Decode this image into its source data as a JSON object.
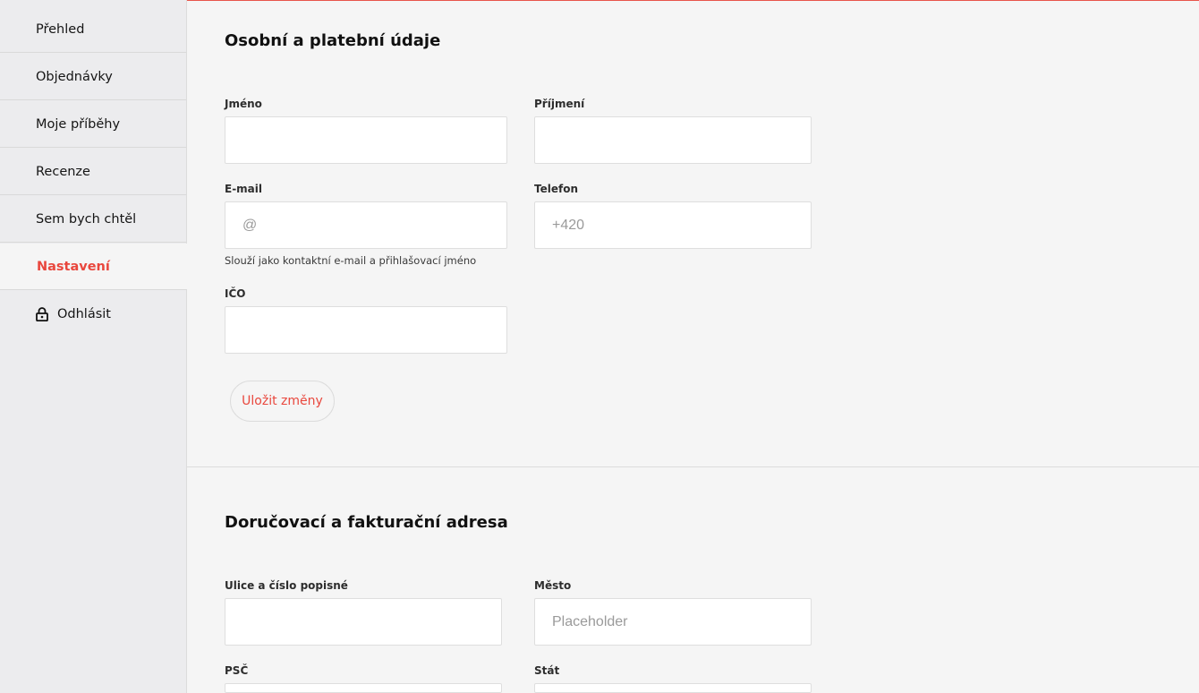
{
  "sidebar": {
    "items": [
      {
        "label": "Přehled"
      },
      {
        "label": "Objednávky"
      },
      {
        "label": "Moje příběhy"
      },
      {
        "label": "Recenze"
      },
      {
        "label": "Sem bych chtěl"
      },
      {
        "label": "Nastavení",
        "active": true
      },
      {
        "label": "Odhlásit",
        "icon": "lock-icon"
      }
    ]
  },
  "personal": {
    "title": "Osobní a platební údaje",
    "first_name": {
      "label": "Jméno",
      "value": "",
      "placeholder": ""
    },
    "last_name": {
      "label": "Příjmení",
      "value": "",
      "placeholder": ""
    },
    "email": {
      "label": "E-mail",
      "value": "",
      "placeholder": "@",
      "help": "Slouží jako kontaktní e-mail a přihlašovací jméno"
    },
    "phone": {
      "label": "Telefon",
      "value": "",
      "placeholder": "+420"
    },
    "ico": {
      "label": "IČO",
      "value": "",
      "placeholder": ""
    },
    "save_label": "Uložit změny"
  },
  "address": {
    "title": "Doručovací a fakturační adresa",
    "street": {
      "label": "Ulice a číslo popisné",
      "value": "",
      "placeholder": ""
    },
    "city": {
      "label": "Město",
      "value": "",
      "placeholder": "Placeholder"
    },
    "zip": {
      "label": "PSČ",
      "value": "",
      "placeholder": ""
    },
    "country": {
      "label": "Stát",
      "value": "",
      "placeholder": ""
    }
  },
  "colors": {
    "accent": "#e9473d",
    "sidebar_bg": "#ececee",
    "page_bg": "#f5f5f5"
  }
}
